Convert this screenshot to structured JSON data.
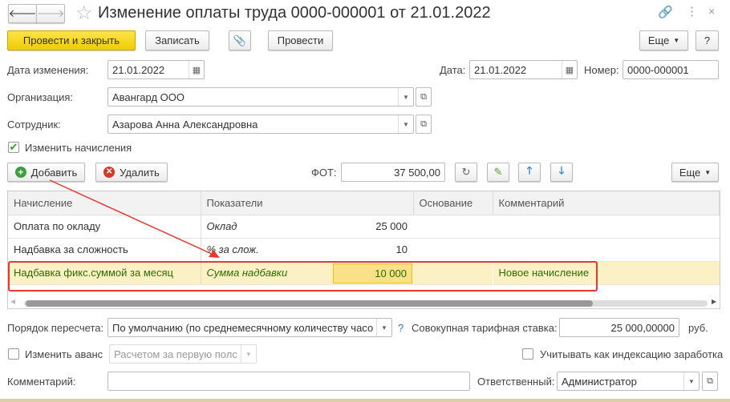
{
  "window": {
    "title": "Изменение оплаты труда 0000-000001 от 21.01.2022"
  },
  "toolbar": {
    "post_close": "Провести и закрыть",
    "save": "Записать",
    "post": "Провести",
    "more": "Еще",
    "help": "?"
  },
  "fields": {
    "change_date_label": "Дата изменения:",
    "change_date": "21.01.2022",
    "date_label": "Дата:",
    "date": "21.01.2022",
    "number_label": "Номер:",
    "number": "0000-000001",
    "org_label": "Организация:",
    "org": "Авангард ООО",
    "employee_label": "Сотрудник:",
    "employee": "Азарова Анна Александровна",
    "change_accruals": "Изменить начисления"
  },
  "table_toolbar": {
    "add": "Добавить",
    "delete": "Удалить",
    "fot_label": "ФОТ:",
    "fot": "37 500,00",
    "more": "Еще"
  },
  "table": {
    "headers": [
      "Начисление",
      "Показатели",
      "Основание",
      "Комментарий"
    ],
    "rows": [
      {
        "accrual": "Оплата по окладу",
        "indicator": "Оклад",
        "value": "25 000",
        "basis": "",
        "comment": ""
      },
      {
        "accrual": "Надбавка за сложность",
        "indicator": "% за слож.",
        "value": "10",
        "basis": "",
        "comment": ""
      },
      {
        "accrual": "Надбавка фикс.суммой за месяц",
        "indicator": "Сумма надбавки",
        "value": "10 000",
        "basis": "",
        "comment": "Новое начисление"
      }
    ]
  },
  "bottom": {
    "recalc_label": "Порядок пересчета:",
    "recalc": "По умолчанию (по среднемесячному количеству часо",
    "help": "?",
    "rate_label": "Совокупная тарифная ставка:",
    "rate": "25 000,00000",
    "currency": "руб.",
    "advance_label": "Изменить аванс",
    "advance": "Расчетом за первую полс",
    "indexation_label": "Учитывать как индексацию заработка",
    "comment_label": "Комментарий:",
    "comment": "",
    "responsible_label": "Ответственный:",
    "responsible": "Администратор"
  },
  "colors": {
    "accent": "#f2cd00",
    "highlight": "#fcf1c4",
    "annotation": "#e53a2f"
  }
}
